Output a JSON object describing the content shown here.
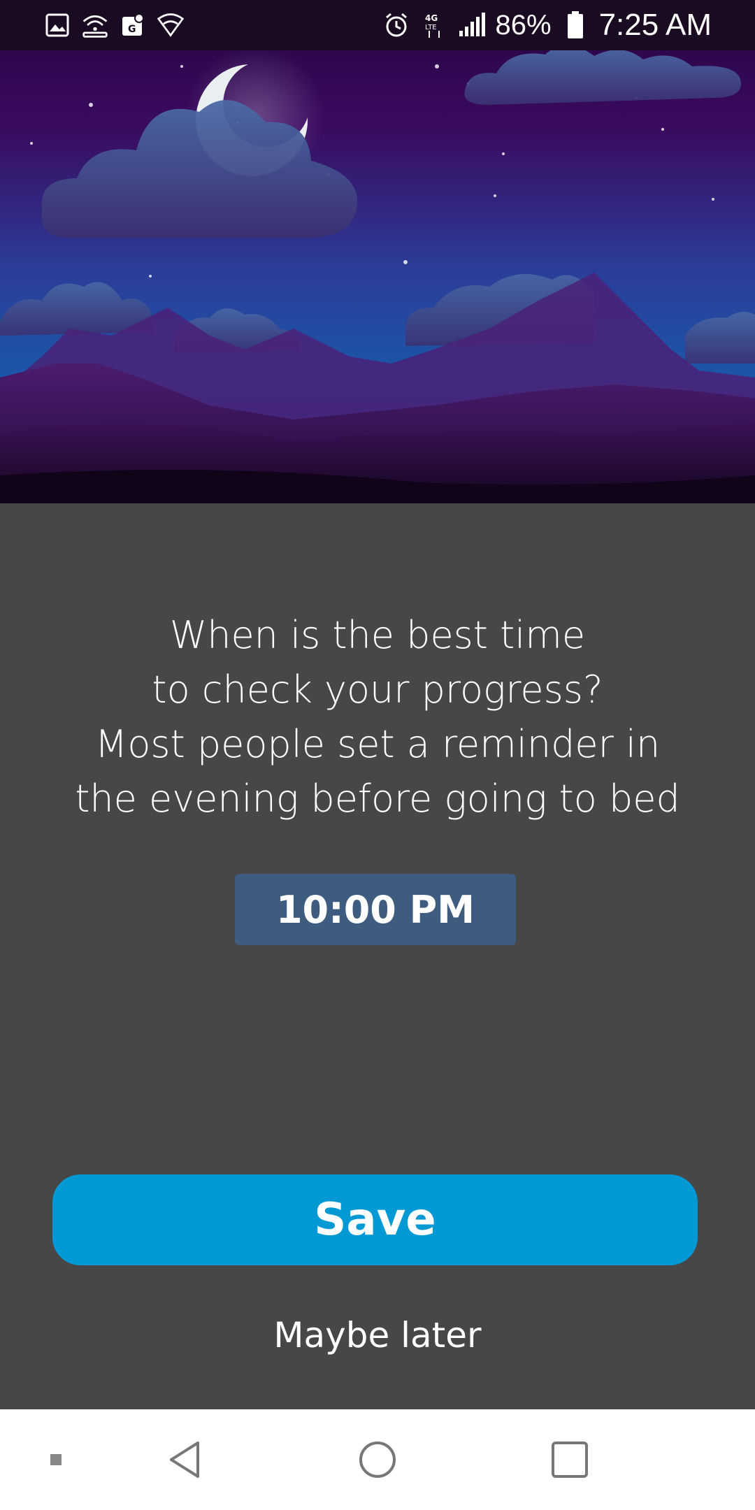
{
  "status_bar": {
    "left_icons": [
      "gallery-icon",
      "wifi-hotspot-icon",
      "maps-icon",
      "wifi-icon"
    ],
    "right_icons": [
      "alarm-icon",
      "lte-data-icon",
      "signal-icon",
      "battery-icon"
    ],
    "network": "4G LTE",
    "battery": "86%",
    "time": "7:25 AM"
  },
  "hero": {
    "illustration": "night-sky-mountains-moon"
  },
  "prompt": {
    "line1": "When is the best time",
    "line2": "to check your progress?",
    "line3": "Most people set a reminder in",
    "line4": "the evening before going to bed"
  },
  "reminder": {
    "time": "10:00 PM"
  },
  "actions": {
    "save_label": "Save",
    "maybe_later_label": "Maybe later"
  },
  "nav_bar": {
    "icons": [
      "recent-dot-icon",
      "back-icon",
      "home-icon",
      "overview-icon"
    ]
  },
  "colors": {
    "background": "#474747",
    "save_button": "#0399d5",
    "time_chip": "#3e5b80",
    "status_bar": "#1a0b22"
  }
}
